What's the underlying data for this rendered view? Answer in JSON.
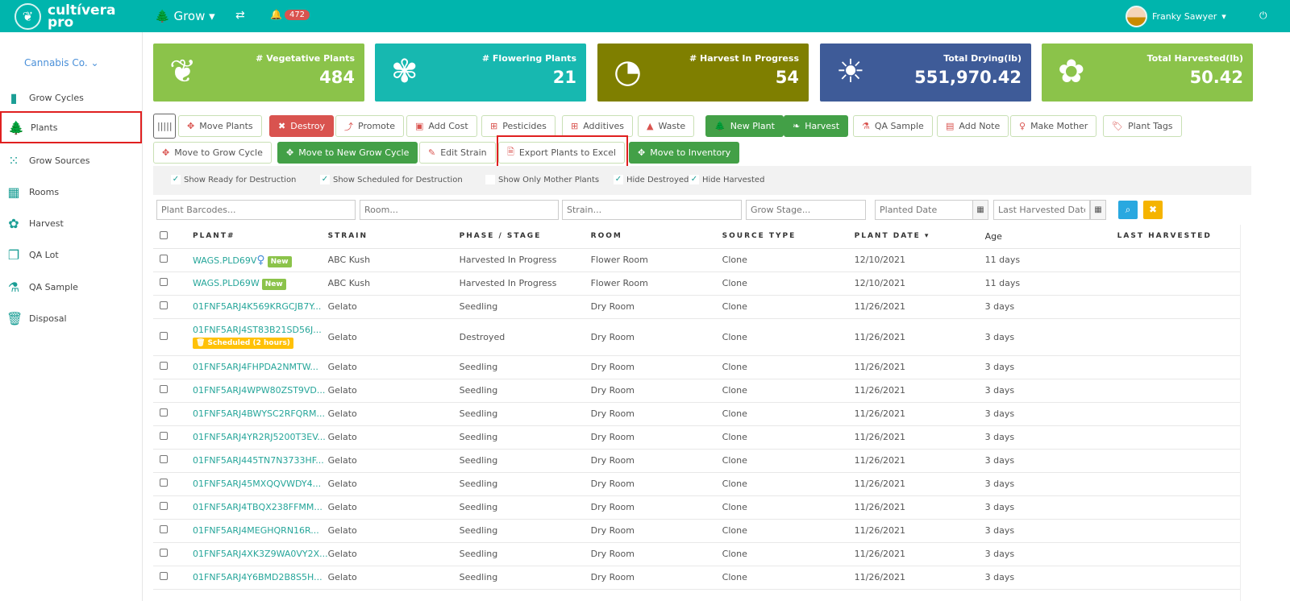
{
  "header": {
    "logo": "cultívera pro",
    "module": "Grow",
    "notifications": "472",
    "user": "Franky Sawyer"
  },
  "sidebar": {
    "company": "Cannabis Co.",
    "items": [
      {
        "label": "Grow Cycles",
        "icon": "bar-chart-icon"
      },
      {
        "label": "Plants",
        "icon": "tree-icon"
      },
      {
        "label": "Grow Sources",
        "icon": "dots-icon"
      },
      {
        "label": "Rooms",
        "icon": "grid-icon"
      },
      {
        "label": "Harvest",
        "icon": "plant-icon"
      },
      {
        "label": "QA Lot",
        "icon": "copy-icon"
      },
      {
        "label": "QA Sample",
        "icon": "flask-icon"
      },
      {
        "label": "Disposal",
        "icon": "trash-icon"
      }
    ]
  },
  "cards": [
    {
      "label": "# Vegetative Plants",
      "value": "484",
      "color": "#8bc34a"
    },
    {
      "label": "# Flowering Plants",
      "value": "21",
      "color": "#17b8b0"
    },
    {
      "label": "# Harvest In Progress",
      "value": "54",
      "color": "#7f7f00"
    },
    {
      "label": "Total Drying(lb)",
      "value": "551,970.42",
      "color": "#3e5b98"
    },
    {
      "label": "Total Harvested(lb)",
      "value": "50.42",
      "color": "#8bc34a"
    }
  ],
  "actions": {
    "move_plants": "Move Plants",
    "destroy": "Destroy",
    "promote": "Promote",
    "add_cost": "Add Cost",
    "pesticides": "Pesticides",
    "additives": "Additives",
    "waste": "Waste",
    "new_plant": "New Plant",
    "harvest": "Harvest",
    "qa_sample": "QA Sample",
    "add_note": "Add Note",
    "make_mother": "Make Mother",
    "plant_tags": "Plant Tags",
    "move_grow_cycle": "Move to Grow Cycle",
    "move_new_grow_cycle": "Move to New Grow Cycle",
    "edit_strain": "Edit Strain",
    "export_excel": "Export Plants to Excel",
    "move_inventory": "Move to Inventory"
  },
  "toggles": [
    {
      "label": "Show Ready for Destruction",
      "checked": true
    },
    {
      "label": "Show Scheduled for Destruction",
      "checked": true
    },
    {
      "label": "Show Only Mother Plants",
      "checked": false
    },
    {
      "label": "Hide Destroyed",
      "checked": true
    },
    {
      "label": "Hide Harvested",
      "checked": true
    }
  ],
  "search": {
    "barcodes": "Plant Barcodes...",
    "room": "Room...",
    "strain": "Strain...",
    "stage": "Grow Stage...",
    "planted": "Planted Date",
    "last_harvested": "Last Harvested Date"
  },
  "table": {
    "headers": [
      "PLANT#",
      "STRAIN",
      "PHASE / STAGE",
      "ROOM",
      "SOURCE TYPE",
      "PLANT DATE ▾",
      "Age",
      "LAST HARVESTED"
    ],
    "rows": [
      [
        "WAGS.PLD69V",
        "ABC Kush",
        "Harvested In Progress",
        "Flower Room",
        "Clone",
        "12/10/2021",
        "11 days",
        ""
      ],
      [
        "WAGS.PLD69W",
        "ABC Kush",
        "Harvested In Progress",
        "Flower Room",
        "Clone",
        "12/10/2021",
        "11 days",
        ""
      ],
      [
        "01FNF5ARJ4K569KRGCJB7Y...",
        "Gelato",
        "Seedling",
        "Dry Room",
        "Clone",
        "11/26/2021",
        "3 days",
        ""
      ],
      [
        "01FNF5ARJ4ST83B21SD56J...",
        "Gelato",
        "Destroyed",
        "Dry Room",
        "Clone",
        "11/26/2021",
        "3 days",
        ""
      ],
      [
        "01FNF5ARJ4FHPDA2NMTW...",
        "Gelato",
        "Seedling",
        "Dry Room",
        "Clone",
        "11/26/2021",
        "3 days",
        ""
      ],
      [
        "01FNF5ARJ4WPW80ZST9VD...",
        "Gelato",
        "Seedling",
        "Dry Room",
        "Clone",
        "11/26/2021",
        "3 days",
        ""
      ],
      [
        "01FNF5ARJ4BWYSC2RFQRM...",
        "Gelato",
        "Seedling",
        "Dry Room",
        "Clone",
        "11/26/2021",
        "3 days",
        ""
      ],
      [
        "01FNF5ARJ4YR2RJ5200T3EV...",
        "Gelato",
        "Seedling",
        "Dry Room",
        "Clone",
        "11/26/2021",
        "3 days",
        ""
      ],
      [
        "01FNF5ARJ445TN7N3733HF...",
        "Gelato",
        "Seedling",
        "Dry Room",
        "Clone",
        "11/26/2021",
        "3 days",
        ""
      ],
      [
        "01FNF5ARJ45MXQQVWDY4...",
        "Gelato",
        "Seedling",
        "Dry Room",
        "Clone",
        "11/26/2021",
        "3 days",
        ""
      ],
      [
        "01FNF5ARJ4TBQX238FFMM...",
        "Gelato",
        "Seedling",
        "Dry Room",
        "Clone",
        "11/26/2021",
        "3 days",
        ""
      ],
      [
        "01FNF5ARJ4MEGHQRN16R...",
        "Gelato",
        "Seedling",
        "Dry Room",
        "Clone",
        "11/26/2021",
        "3 days",
        ""
      ],
      [
        "01FNF5ARJ4XK3Z9WA0VY2X...",
        "Gelato",
        "Seedling",
        "Dry Room",
        "Clone",
        "11/26/2021",
        "3 days",
        ""
      ],
      [
        "01FNF5ARJ4Y6BMD2B8S5H...",
        "Gelato",
        "Seedling",
        "Dry Room",
        "Clone",
        "11/26/2021",
        "3 days",
        ""
      ]
    ],
    "new_badge": "New",
    "scheduled_badge": "🗑 Scheduled (2 hours)"
  }
}
